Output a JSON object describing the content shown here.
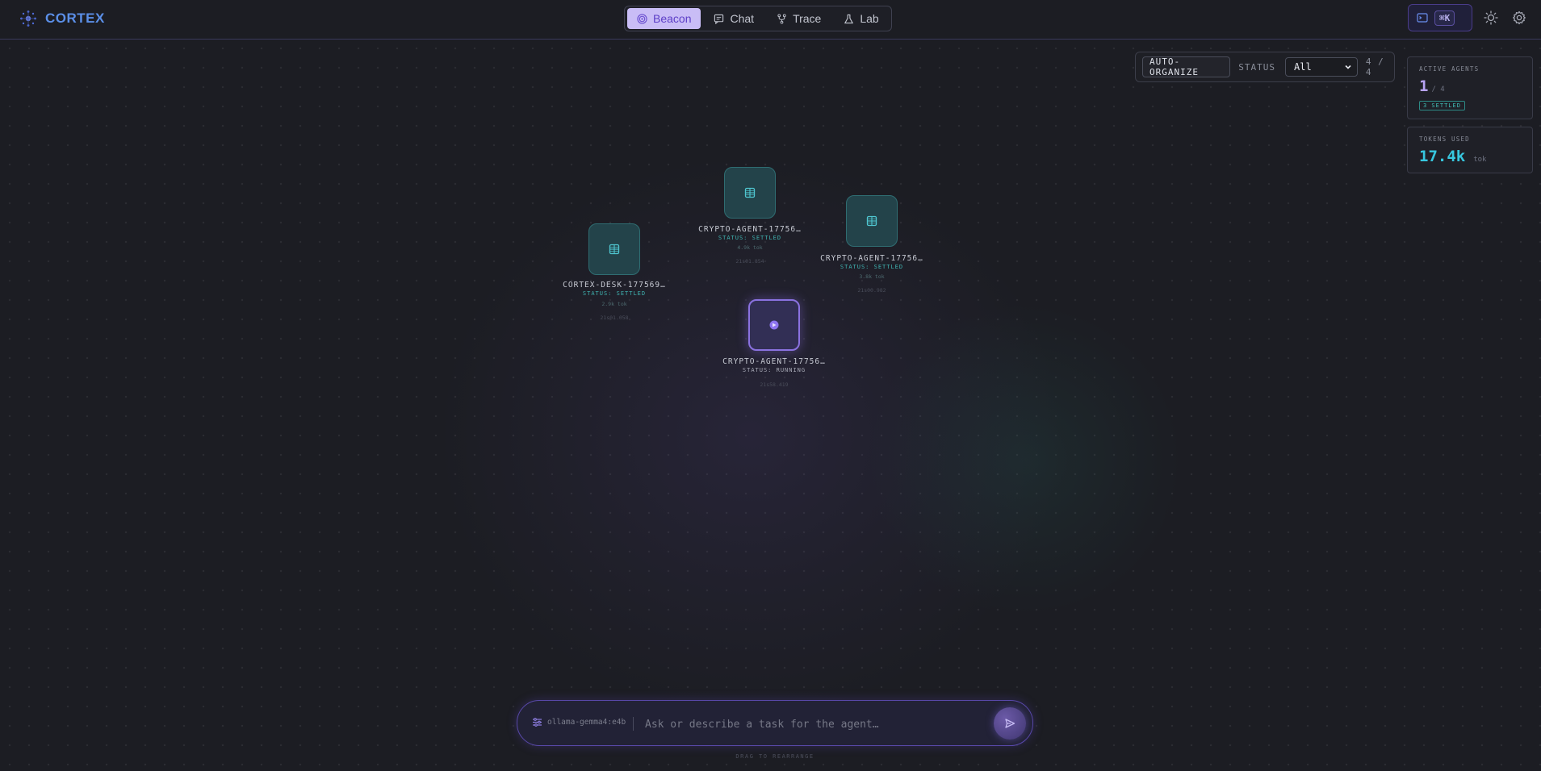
{
  "app": {
    "name": "CORTEX"
  },
  "nav": {
    "tabs": [
      {
        "label": "Beacon",
        "icon": "beacon-icon",
        "active": true
      },
      {
        "label": "Chat",
        "icon": "chat-icon",
        "active": false
      },
      {
        "label": "Trace",
        "icon": "trace-icon",
        "active": false
      },
      {
        "label": "Lab",
        "icon": "flask-icon",
        "active": false
      }
    ]
  },
  "header": {
    "shortcut_label": "⌘K",
    "terminal_icon": "terminal-icon",
    "theme_icon": "sun-icon",
    "settings_icon": "gear-icon"
  },
  "filter": {
    "auto_organize_label": "AUTO-ORGANIZE",
    "status_label": "STATUS",
    "status_value": "All",
    "count": "4 / 4"
  },
  "stats": {
    "active_agents": {
      "title": "ACTIVE AGENTS",
      "value": "1",
      "total": "/ 4",
      "badge": "3 SETTLED"
    },
    "tokens_used": {
      "title": "TOKENS USED",
      "value": "17.4k",
      "unit": "tok"
    }
  },
  "agents": [
    {
      "name": "CORTEX-DESK-177569…",
      "status": "STATUS: SETTLED",
      "tokens": "2.9k tok",
      "time": "21s01.058",
      "state": "settled",
      "icon": "grid-icon"
    },
    {
      "name": "CRYPTO-AGENT-17756…",
      "status": "STATUS: SETTLED",
      "tokens": "4.9k tok",
      "time": "21s01.854",
      "state": "settled",
      "icon": "grid-icon"
    },
    {
      "name": "CRYPTO-AGENT-17756…",
      "status": "STATUS: SETTLED",
      "tokens": "3.8k tok",
      "time": "21s00.982",
      "state": "settled",
      "icon": "grid-icon"
    },
    {
      "name": "CRYPTO-AGENT-17756…",
      "status": "STATUS: RUNNING",
      "tokens": "",
      "time": "21s58.419",
      "state": "running",
      "icon": "agent-running-icon"
    }
  ],
  "composer": {
    "model": "ollama-gemma4:e4b",
    "placeholder": "Ask or describe a task for the agent…",
    "send_icon": "send-icon",
    "hint": "DRAG TO REARRANGE"
  },
  "colors": {
    "accent": "#8a72e0",
    "brand": "#5b8fe8",
    "settled": "#3fb3b0",
    "tokens": "#37c7df"
  }
}
